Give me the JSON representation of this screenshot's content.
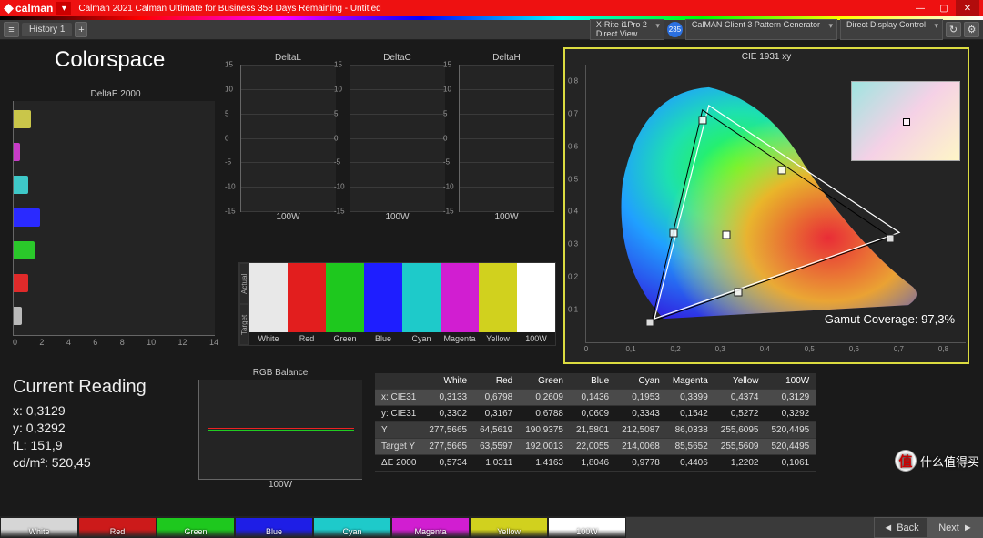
{
  "titlebar": {
    "brand": "calman",
    "title": "Calman 2021 Calman Ultimate for Business 358 Days Remaining   -   Untitled"
  },
  "toolbar": {
    "history_tab": "History 1",
    "dev1_line1": "X-Rite i1Pro 2",
    "dev1_line2": "Direct View",
    "circle": "235",
    "dev2": "CalMAN Client 3 Pattern Generator",
    "dev3": "Direct Display Control"
  },
  "page_title": "Colorspace",
  "deltaE": {
    "title": "DeltaE 2000",
    "colors": [
      "#c9c64a",
      "#c83bc8",
      "#3ec8c8",
      "#2a2aff",
      "#2ac82a",
      "#e02a2a",
      "#bababa"
    ],
    "values": [
      1.22,
      0.44,
      0.98,
      1.8,
      1.42,
      1.03,
      0.57
    ],
    "xticks": [
      "0",
      "2",
      "4",
      "6",
      "8",
      "10",
      "12",
      "14"
    ]
  },
  "small": {
    "titles": [
      "DeltaL",
      "DeltaC",
      "DeltaH"
    ],
    "yticks": [
      "15",
      "10",
      "5",
      "0",
      "-5",
      "-10",
      "-15"
    ],
    "xtick": "100W"
  },
  "swatches": {
    "row_labels": [
      "Actual",
      "Target"
    ],
    "items": [
      {
        "label": "White",
        "c": "#e8e8e8"
      },
      {
        "label": "Red",
        "c": "#e21e1e"
      },
      {
        "label": "Green",
        "c": "#1ec81e"
      },
      {
        "label": "Blue",
        "c": "#1e1eff"
      },
      {
        "label": "Cyan",
        "c": "#1ecaca"
      },
      {
        "label": "Magenta",
        "c": "#d11ed1"
      },
      {
        "label": "Yellow",
        "c": "#d1d11e"
      },
      {
        "label": "100W",
        "c": "#ffffff"
      }
    ]
  },
  "cie": {
    "title": "CIE 1931 xy",
    "coverage_label": "Gamut Coverage:  97,3%",
    "xticks": [
      "0",
      "0,1",
      "0,2",
      "0,3",
      "0,4",
      "0,5",
      "0,6",
      "0,7",
      "0,8"
    ],
    "yticks": [
      "0,1",
      "0,2",
      "0,3",
      "0,4",
      "0,5",
      "0,6",
      "0,7",
      "0,8"
    ]
  },
  "readings": {
    "heading": "Current Reading",
    "x": "x: 0,3129",
    "y": "y: 0,3292",
    "fl": "fL: 151,9",
    "cdm2": "cd/m²: 520,45"
  },
  "rgb": {
    "title": "RGB Balance",
    "xtick": "100W"
  },
  "table": {
    "cols": [
      "",
      "White",
      "Red",
      "Green",
      "Blue",
      "Cyan",
      "Magenta",
      "Yellow",
      "100W"
    ],
    "rows": [
      {
        "k": "x: CIE31",
        "v": [
          "0,3133",
          "0,6798",
          "0,2609",
          "0,1436",
          "0,1953",
          "0,3399",
          "0,4374",
          "0,3129"
        ],
        "hl": true
      },
      {
        "k": "y: CIE31",
        "v": [
          "0,3302",
          "0,3167",
          "0,6788",
          "0,0609",
          "0,3343",
          "0,1542",
          "0,5272",
          "0,3292"
        ]
      },
      {
        "k": "Y",
        "v": [
          "277,5665",
          "64,5619",
          "190,9375",
          "21,5801",
          "212,5087",
          "86,0338",
          "255,6095",
          "520,4495"
        ],
        "hl2": true
      },
      {
        "k": "Target Y",
        "v": [
          "277,5665",
          "63,5597",
          "192,0013",
          "22,0055",
          "214,0068",
          "85,5652",
          "255,5609",
          "520,4495"
        ],
        "hl": true
      },
      {
        "k": "ΔE 2000",
        "v": [
          "0,5734",
          "1,0311",
          "1,4163",
          "1,8046",
          "0,9778",
          "0,4406",
          "1,2202",
          "0,1061"
        ]
      }
    ]
  },
  "bottom": {
    "items": [
      {
        "label": "White",
        "c": "#d6d6d6"
      },
      {
        "label": "Red",
        "c": "#cc1a1a"
      },
      {
        "label": "Green",
        "c": "#1ec81e"
      },
      {
        "label": "Blue",
        "c": "#1e1ee6"
      },
      {
        "label": "Cyan",
        "c": "#1ecaca"
      },
      {
        "label": "Magenta",
        "c": "#d11ed1"
      },
      {
        "label": "Yellow",
        "c": "#d1d11e"
      },
      {
        "label": "100W",
        "c": "#ffffff"
      }
    ],
    "back": "Back",
    "next": "Next"
  },
  "overlay": {
    "char": "值",
    "text": "什么值得买"
  },
  "chart_data": [
    {
      "type": "bar",
      "title": "DeltaE 2000",
      "categories": [
        "Yellow",
        "Magenta",
        "Cyan",
        "Blue",
        "Green",
        "Red",
        "White"
      ],
      "values": [
        1.22,
        0.44,
        0.98,
        1.8,
        1.42,
        1.03,
        0.57
      ],
      "xlabel": "",
      "ylabel": "",
      "xlim": [
        0,
        14
      ]
    },
    {
      "type": "bar",
      "title": "DeltaL",
      "categories": [
        "100W"
      ],
      "values": [
        0
      ],
      "ylim": [
        -15,
        15
      ]
    },
    {
      "type": "bar",
      "title": "DeltaC",
      "categories": [
        "100W"
      ],
      "values": [
        0
      ],
      "ylim": [
        -15,
        15
      ]
    },
    {
      "type": "bar",
      "title": "DeltaH",
      "categories": [
        "100W"
      ],
      "values": [
        0
      ],
      "ylim": [
        -15,
        15
      ]
    },
    {
      "type": "scatter",
      "title": "CIE 1931 xy",
      "series": [
        {
          "name": "White",
          "values": [
            [
              0.3133,
              0.3302
            ]
          ]
        },
        {
          "name": "Red",
          "values": [
            [
              0.6798,
              0.3167
            ]
          ]
        },
        {
          "name": "Green",
          "values": [
            [
              0.2609,
              0.6788
            ]
          ]
        },
        {
          "name": "Blue",
          "values": [
            [
              0.1436,
              0.0609
            ]
          ]
        },
        {
          "name": "Cyan",
          "values": [
            [
              0.1953,
              0.3343
            ]
          ]
        },
        {
          "name": "Magenta",
          "values": [
            [
              0.3399,
              0.1542
            ]
          ]
        },
        {
          "name": "Yellow",
          "values": [
            [
              0.4374,
              0.5272
            ]
          ]
        },
        {
          "name": "100W",
          "values": [
            [
              0.3129,
              0.3292
            ]
          ]
        }
      ],
      "xlim": [
        0,
        0.85
      ],
      "ylim": [
        0,
        0.85
      ]
    },
    {
      "type": "line",
      "title": "RGB Balance",
      "categories": [
        "100W"
      ],
      "series": [
        {
          "name": "R",
          "values": [
            0
          ]
        },
        {
          "name": "G",
          "values": [
            0
          ]
        },
        {
          "name": "B",
          "values": [
            0
          ]
        }
      ],
      "ylim": [
        -4,
        4
      ]
    },
    {
      "type": "table",
      "title": "Readings",
      "columns": [
        "",
        "White",
        "Red",
        "Green",
        "Blue",
        "Cyan",
        "Magenta",
        "Yellow",
        "100W"
      ],
      "rows": [
        [
          "x: CIE31",
          "0,3133",
          "0,6798",
          "0,2609",
          "0,1436",
          "0,1953",
          "0,3399",
          "0,4374",
          "0,3129"
        ],
        [
          "y: CIE31",
          "0,3302",
          "0,3167",
          "0,6788",
          "0,0609",
          "0,3343",
          "0,1542",
          "0,5272",
          "0,3292"
        ],
        [
          "Y",
          "277,5665",
          "64,5619",
          "190,9375",
          "21,5801",
          "212,5087",
          "86,0338",
          "255,6095",
          "520,4495"
        ],
        [
          "Target Y",
          "277,5665",
          "63,5597",
          "192,0013",
          "22,0055",
          "214,0068",
          "85,5652",
          "255,5609",
          "520,4495"
        ],
        [
          "ΔE 2000",
          "0,5734",
          "1,0311",
          "1,4163",
          "1,8046",
          "0,9778",
          "0,4406",
          "1,2202",
          "0,1061"
        ]
      ]
    }
  ]
}
